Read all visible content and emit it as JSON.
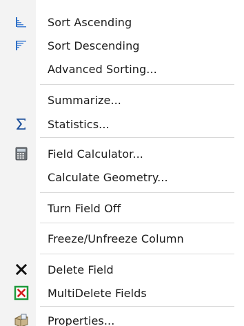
{
  "menu": {
    "items": [
      {
        "label": "Sort Ascending",
        "icon": "sort-ascending-icon"
      },
      {
        "label": "Sort Descending",
        "icon": "sort-descending-icon"
      },
      {
        "label": "Advanced Sorting...",
        "icon": ""
      },
      {
        "label": "Summarize...",
        "icon": ""
      },
      {
        "label": "Statistics...",
        "icon": "sigma-icon"
      },
      {
        "label": "Field Calculator...",
        "icon": "calculator-icon"
      },
      {
        "label": "Calculate Geometry...",
        "icon": ""
      },
      {
        "label": "Turn Field Off",
        "icon": ""
      },
      {
        "label": "Freeze/Unfreeze Column",
        "icon": ""
      },
      {
        "label": "Delete Field",
        "icon": "delete-x-icon"
      },
      {
        "label": "MultiDelete Fields",
        "icon": "multidelete-icon"
      },
      {
        "label": "Properties...",
        "icon": "properties-icon"
      }
    ]
  },
  "colors": {
    "accent_blue": "#2f6fc4",
    "delete_green": "#1f9a3c",
    "delete_red": "#d42020",
    "text": "#1a1a1a",
    "separator": "#d8d8d8"
  }
}
